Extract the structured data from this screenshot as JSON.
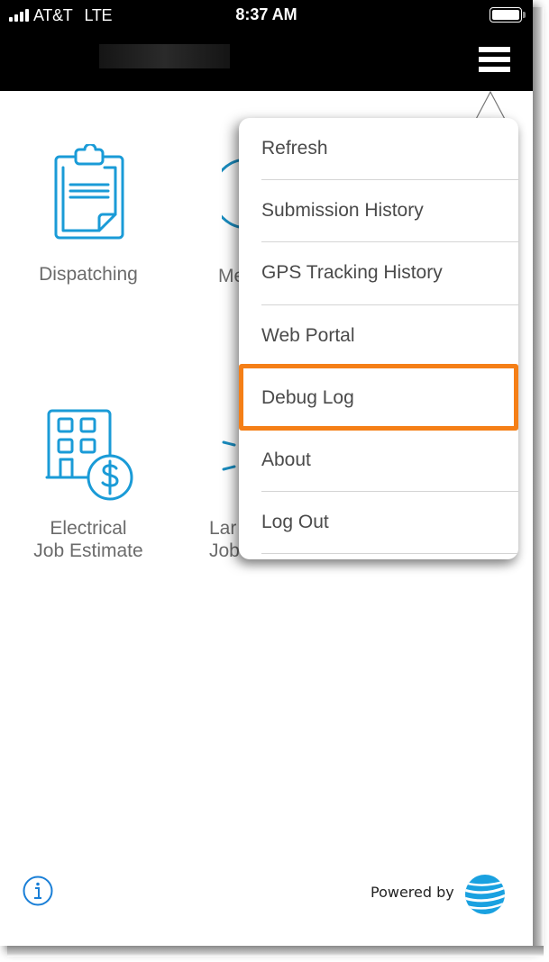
{
  "status_bar": {
    "carrier": "AT&T",
    "network": "LTE",
    "time": "8:37 AM",
    "signal_bars": 4,
    "battery_percent": 100
  },
  "nav": {
    "title_redacted": true,
    "menu_icon": "hamburger-menu-icon"
  },
  "tiles": [
    {
      "label": "Dispatching",
      "icon": "clipboard-icon"
    },
    {
      "label_line1": "Electrical",
      "label_line2": "Job Estimate",
      "icon": "building-dollar-icon"
    }
  ],
  "partial_tiles": [
    {
      "text": "Me"
    },
    {
      "text_line1": "Lar",
      "text_line2": "Job"
    }
  ],
  "menu": {
    "items": [
      {
        "label": "Refresh"
      },
      {
        "label": "Submission History"
      },
      {
        "label": "GPS Tracking History"
      },
      {
        "label": "Web Portal"
      },
      {
        "label": "Debug Log",
        "highlighted": true
      },
      {
        "label": "About"
      },
      {
        "label": "Log Out"
      }
    ]
  },
  "footer": {
    "info_icon": "info-icon",
    "powered_by": "Powered by",
    "logo": "att-globe-logo"
  },
  "colors": {
    "accent_blue": "#1a9bd7",
    "highlight_orange": "#f57f17",
    "topbar": "#000000",
    "menu_text": "#4a4a4a",
    "tile_text": "#6b6b6b"
  }
}
